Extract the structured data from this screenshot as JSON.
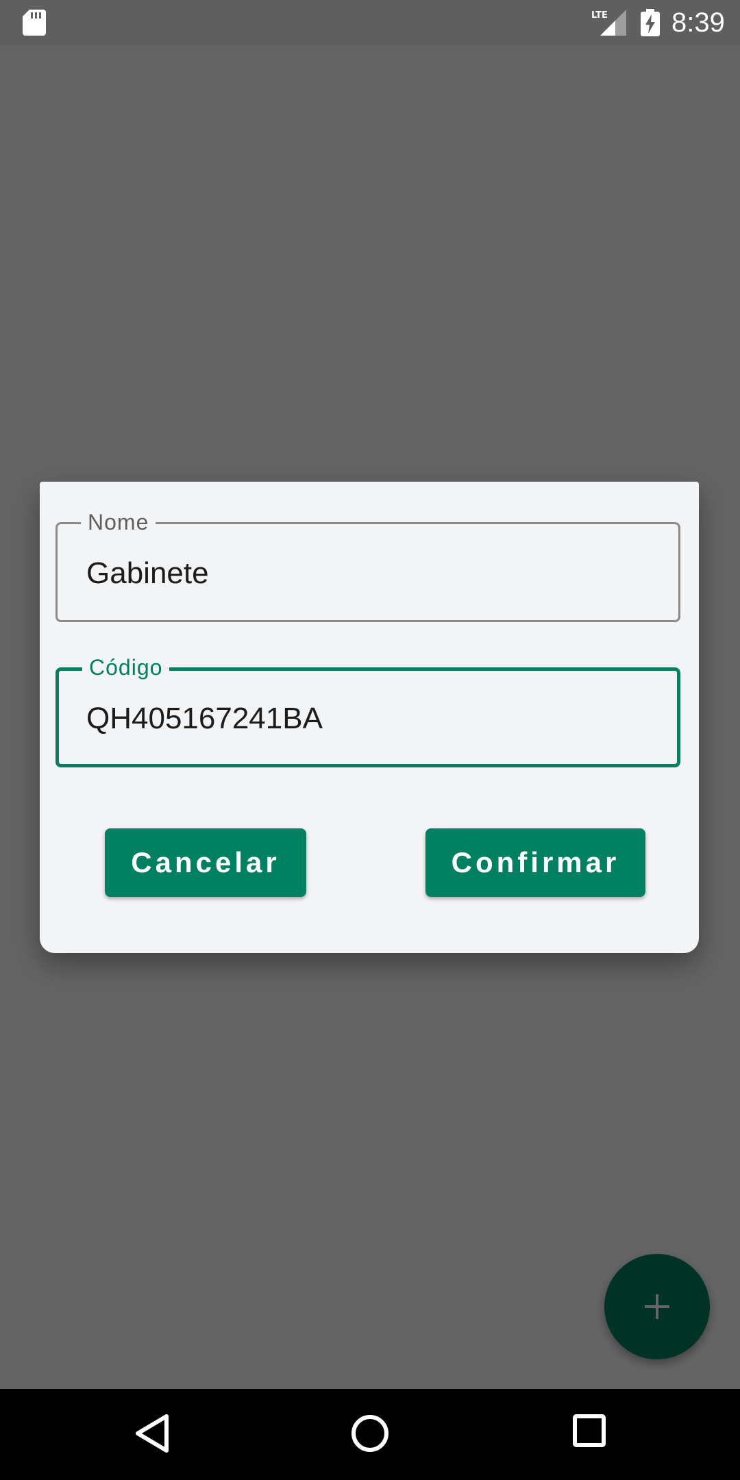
{
  "status_bar": {
    "time": "8:39",
    "network": "LTE",
    "icons": [
      "sd-card-icon",
      "lte-signal-icon",
      "battery-charging-icon"
    ]
  },
  "dialog": {
    "name_field": {
      "label": "Nome",
      "value": "Gabinete"
    },
    "code_field": {
      "label": "Código",
      "value": "QH405167241BA"
    },
    "cancel_label": "Cancelar",
    "confirm_label": "Confirmar"
  },
  "fab": {
    "icon": "plus-icon"
  },
  "nav_bar": {
    "icons": [
      "back-icon",
      "home-icon",
      "recents-icon"
    ]
  },
  "colors": {
    "accent": "#008060",
    "dialog_background": "#f3f4f6",
    "scrim": "#666666"
  }
}
